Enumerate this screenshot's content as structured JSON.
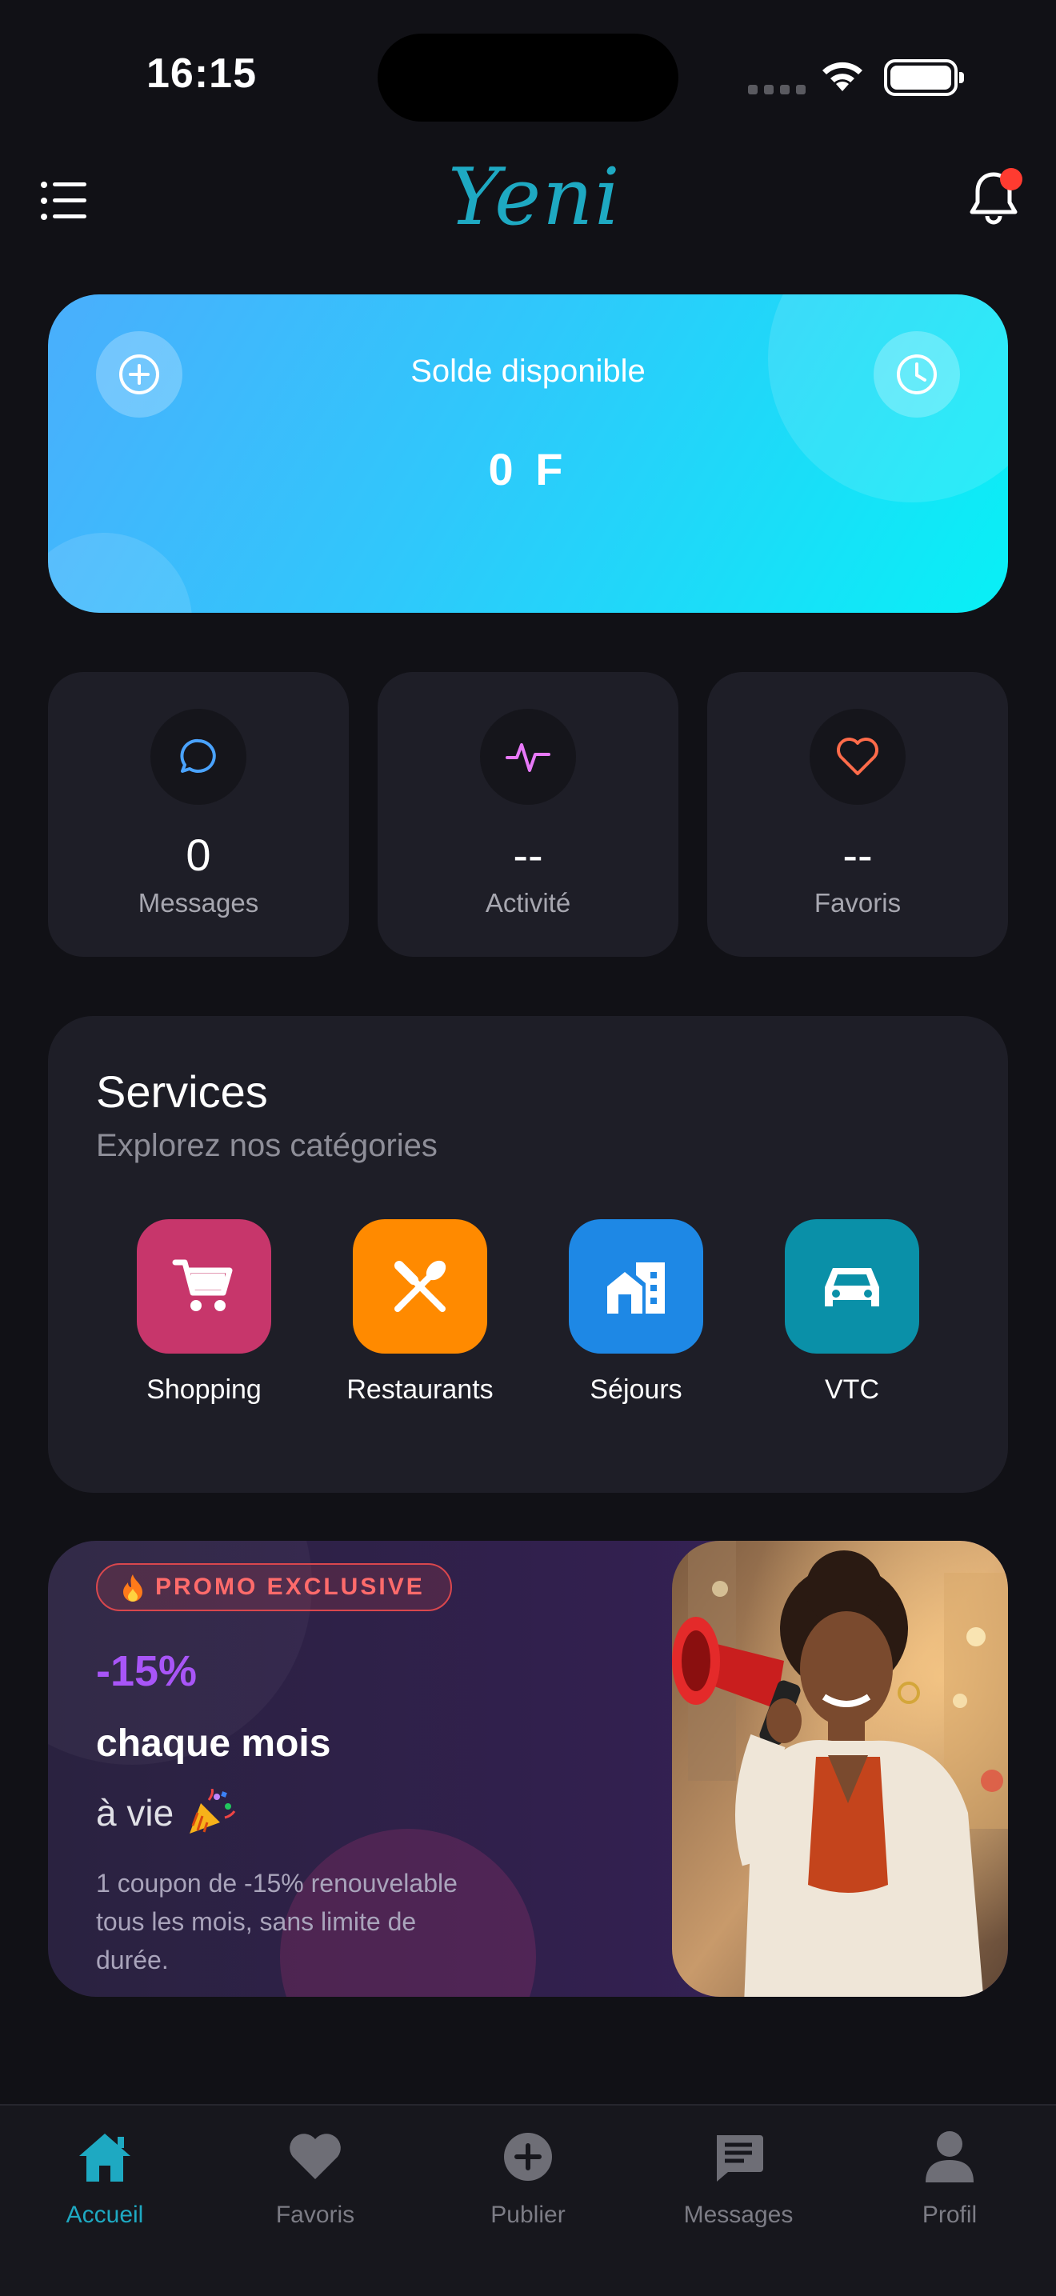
{
  "status_bar": {
    "time": "16:15"
  },
  "header": {
    "logo": "Yeni"
  },
  "balance": {
    "label": "Solde disponible",
    "amount": "0 F"
  },
  "stats": [
    {
      "value": "0",
      "label": "Messages",
      "icon": "chat-bubble-icon",
      "color": "#4aa3ff"
    },
    {
      "value": "--",
      "label": "Activité",
      "icon": "activity-pulse-icon",
      "color": "#e879f9"
    },
    {
      "value": "--",
      "label": "Favoris",
      "icon": "heart-icon",
      "color": "#ff6b4a"
    }
  ],
  "services": {
    "title": "Services",
    "subtitle": "Explorez nos catégories",
    "items": [
      {
        "label": "Shopping",
        "icon": "cart-icon",
        "color": "#c7366b"
      },
      {
        "label": "Restaurants",
        "icon": "utensils-icon",
        "color": "#ff8a00"
      },
      {
        "label": "Séjours",
        "icon": "building-icon",
        "color": "#1e88e5"
      },
      {
        "label": "VTC",
        "icon": "car-icon",
        "color": "#0a90a8"
      }
    ]
  },
  "promo": {
    "badge": "PROMO EXCLUSIVE",
    "discount": "-15%",
    "line1": "chaque mois",
    "line2": "à vie",
    "description": "1 coupon de -15% renouvelable tous les mois, sans limite de durée."
  },
  "bottom_nav": [
    {
      "label": "Accueil",
      "icon": "home-icon",
      "active": true
    },
    {
      "label": "Favoris",
      "icon": "heart-icon",
      "active": false
    },
    {
      "label": "Publier",
      "icon": "plus-circle-icon",
      "active": false
    },
    {
      "label": "Messages",
      "icon": "message-icon",
      "active": false
    },
    {
      "label": "Profil",
      "icon": "person-icon",
      "active": false
    }
  ],
  "colors": {
    "accent": "#1ea9c2",
    "background": "#111116",
    "card": "#1e1e27",
    "promo_purple": "#a855f7",
    "promo_red": "#ff6b6b"
  }
}
